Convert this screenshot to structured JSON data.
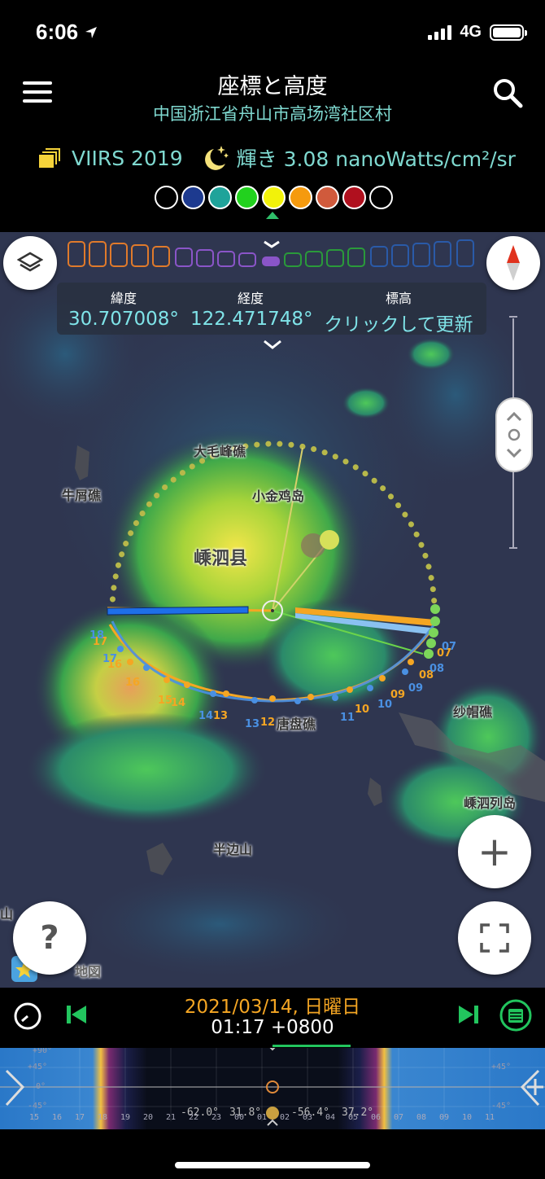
{
  "status": {
    "time": "6:06",
    "network": "4G"
  },
  "header": {
    "title": "座標と高度",
    "location": "中国浙江省舟山市高场湾社区村",
    "dataset": "VIIRS 2019",
    "brightness": "輝き 3.08 nanoWatts/cm²/sr",
    "swatch_colors": [
      "#000000",
      "#1d3a8f",
      "#1fa39a",
      "#22d11e",
      "#f2f20a",
      "#f59a0e",
      "#d05a3c",
      "#b0101e",
      "#000000"
    ],
    "selected_swatch": 4
  },
  "coords": {
    "lat_label": "緯度",
    "lat_value": "30.707008°",
    "lon_label": "経度",
    "lon_value": "122.471748°",
    "elev_label": "標高",
    "elev_value": "クリックして更新"
  },
  "map": {
    "places": {
      "p1": "牛屑礁",
      "p2": "大毛峰礁",
      "p3": "小金鸡岛",
      "p4": "嵊泗县",
      "p5": "唐盘礁",
      "p6": "纱帽礁",
      "p7": "嵊泗列岛",
      "p8": "半边山",
      "p9": "山",
      "p10": "地図"
    },
    "sun_hours_orange": [
      "17",
      "16",
      "16",
      "15",
      "14",
      "13",
      "12",
      "10",
      "09",
      "08",
      "07"
    ],
    "sun_hours_blue": [
      "18",
      "17",
      "14",
      "13",
      "11",
      "10",
      "09",
      "08",
      "07"
    ]
  },
  "buttons": {
    "help": "?",
    "zoom_in": "+"
  },
  "bottom": {
    "date": "2021/03/14, 日曜日",
    "time": "01:17 +0800"
  },
  "timeline": {
    "left_angle": "-62.0°",
    "left_angle2": "31.8°",
    "right_angle": "-56.4°",
    "right_angle2": "37.2°",
    "y_labels": [
      "+90°",
      "+45°",
      "0°",
      "-45°",
      "-90°"
    ],
    "hours": [
      "15",
      "16",
      "17",
      "18",
      "19",
      "20",
      "21",
      "22",
      "23",
      "00",
      "01",
      "02",
      "03",
      "04",
      "05",
      "06",
      "07",
      "08",
      "09",
      "10",
      "11"
    ]
  },
  "colors": {
    "accent_teal": "#7fd9d0",
    "date_orange": "#f5a623",
    "nav_green": "#22c55e",
    "sun_orange": "#f5a623",
    "sun_blue": "#4a90e2"
  }
}
